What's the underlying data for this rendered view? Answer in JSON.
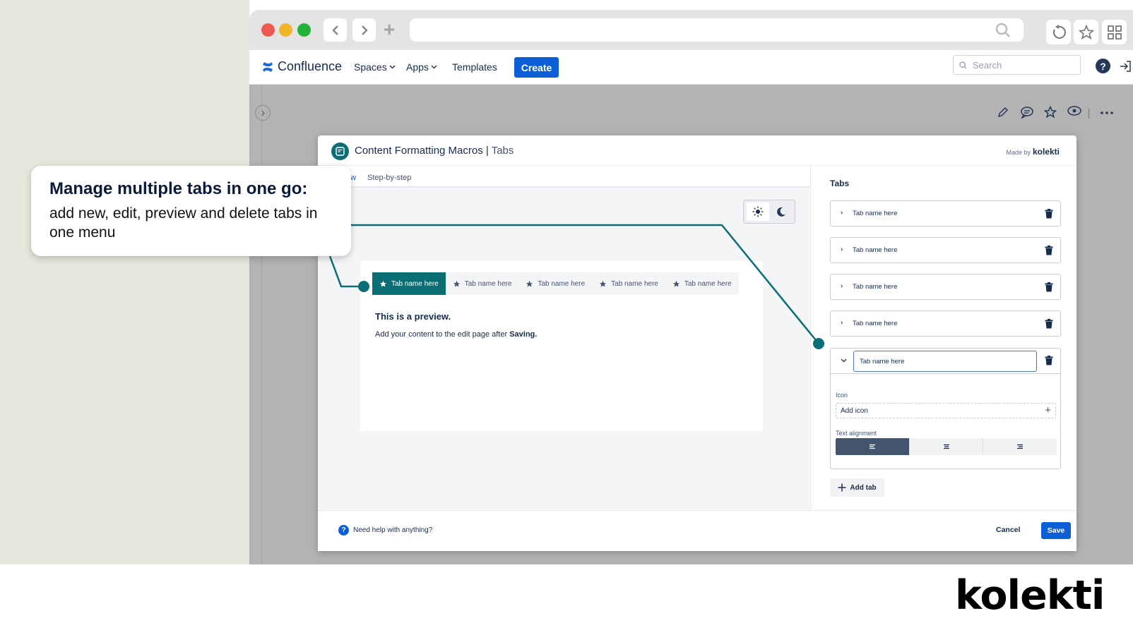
{
  "browser": {
    "url": "",
    "icons": [
      "chevron-left-icon",
      "chevron-right-icon",
      "plus-icon",
      "search-icon",
      "reload-icon",
      "star-icon",
      "grid-icon"
    ]
  },
  "nav": {
    "brand": "Confluence",
    "items": [
      {
        "label": "Spaces",
        "has_dropdown": true
      },
      {
        "label": "Apps",
        "has_dropdown": true
      },
      {
        "label": "Templates",
        "has_dropdown": false
      }
    ],
    "create_label": "Create",
    "search_placeholder": "Search"
  },
  "modal": {
    "title": "Content Formatting Macros",
    "title_sub": "Tabs",
    "made_by_prefix": "Made by",
    "made_by_brand": "kolekti",
    "view_tabs": [
      "ew",
      "Step-by-step"
    ],
    "preview": {
      "tabs": [
        {
          "label": "Tab name here",
          "active": true
        },
        {
          "label": "Tab name here",
          "active": false
        },
        {
          "label": "Tab name here",
          "active": false
        },
        {
          "label": "Tab name here",
          "active": false
        },
        {
          "label": "Tab name here",
          "active": false
        }
      ],
      "heading": "This is a preview.",
      "text_before": "Add your content to the edit page after ",
      "text_bold": "Saving."
    },
    "panel": {
      "title": "Tabs",
      "tab_items": [
        "Tab name here",
        "Tab name here",
        "Tab name here",
        "Tab name here"
      ],
      "expanded": {
        "name_value": "Tab name here",
        "icon_label": "Icon",
        "icon_field": "Add icon",
        "alignment_label": "Text alignment",
        "alignment_options": [
          "left",
          "center",
          "right"
        ],
        "alignment_selected": "left"
      },
      "add_tab_label": "Add tab"
    },
    "footer": {
      "help_text": "Need help with anything?",
      "cancel_label": "Cancel",
      "save_label": "Save"
    }
  },
  "callout": {
    "heading": "Manage multiple tabs in one go:",
    "body": "add new, edit, preview and delete tabs in one menu"
  },
  "brand_logo": "kolekti",
  "colors": {
    "accent_teal": "#0b6e74",
    "primary_blue": "#0c5fd6",
    "background_left": "#e6e7dd"
  }
}
